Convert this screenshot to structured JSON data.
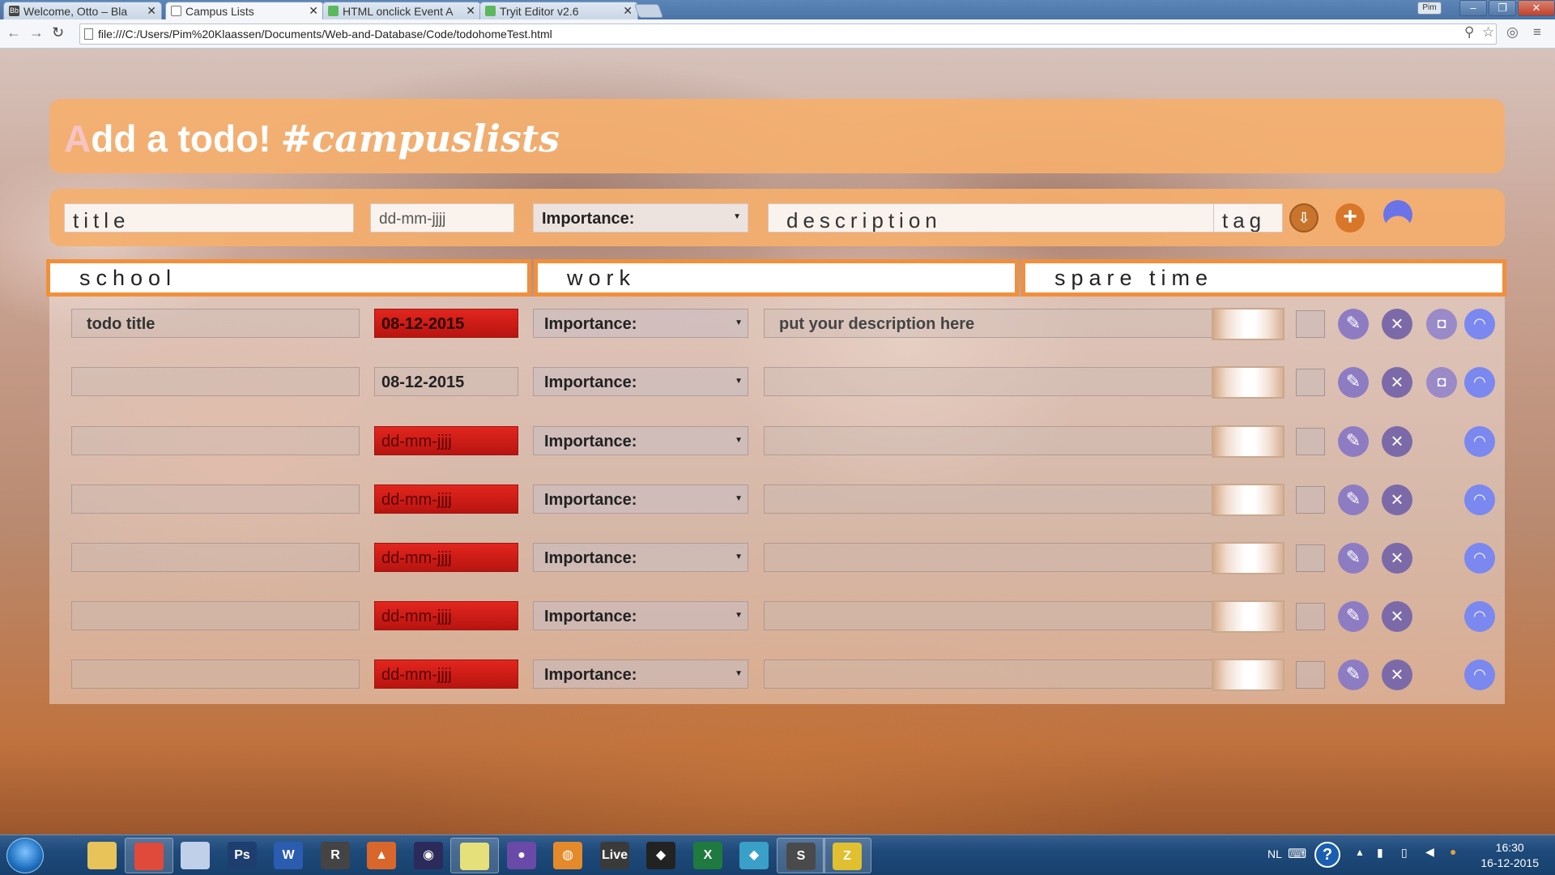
{
  "browser": {
    "tabs": [
      {
        "label": "Welcome, Otto – Bla",
        "icon": "blackboard-icon",
        "icon_color": "#444444"
      },
      {
        "label": "Campus Lists",
        "icon": "page-icon",
        "icon_color": "#ffffff",
        "active": true
      },
      {
        "label": "HTML onclick Event A",
        "icon": "w3schools-icon",
        "icon_color": "#5cb85c"
      },
      {
        "label": "Tryit Editor v2.6",
        "icon": "w3schools-icon",
        "icon_color": "#5cb85c"
      }
    ],
    "url": "file:///C:/Users/Pim%20Klaassen/Documents/Web-and-Database/Code/todohomeTest.html",
    "profile_badge": "Pim",
    "window_buttons": {
      "minimize": "–",
      "maximize": "❐",
      "close": "✕"
    }
  },
  "header": {
    "first_letter": "A",
    "rest": "dd a todo!",
    "tagline": "#campuslists"
  },
  "new_todo": {
    "title_placeholder": "title",
    "date_placeholder": "dd-mm-jjjj",
    "importance_label": "Importance:",
    "description_placeholder": "description",
    "tag_placeholder": "tag"
  },
  "categories": [
    "school",
    "work",
    "spare time"
  ],
  "todos": [
    {
      "title": "todo title",
      "date": "08-12-2015",
      "overdue": true,
      "importance": "Importance:",
      "description": "put your description here",
      "has_save": true
    },
    {
      "title": "",
      "date": "08-12-2015",
      "overdue": false,
      "importance": "Importance:",
      "description": "",
      "has_save": true
    },
    {
      "title": "",
      "date": "dd-mm-jjjj",
      "overdue": true,
      "importance": "Importance:",
      "description": "",
      "has_save": false
    },
    {
      "title": "",
      "date": "dd-mm-jjjj",
      "overdue": true,
      "importance": "Importance:",
      "description": "",
      "has_save": false
    },
    {
      "title": "",
      "date": "dd-mm-jjjj",
      "overdue": true,
      "importance": "Importance:",
      "description": "",
      "has_save": false
    },
    {
      "title": "",
      "date": "dd-mm-jjjj",
      "overdue": true,
      "importance": "Importance:",
      "description": "",
      "has_save": false
    },
    {
      "title": "",
      "date": "dd-mm-jjjj",
      "overdue": true,
      "importance": "Importance:",
      "description": "",
      "has_save": false
    }
  ],
  "colors": {
    "panel_orange": "#f5af6e",
    "tab_border": "#f28f3a",
    "overdue_red": "#d01e18",
    "edit_purple": "#8e7cc3",
    "user_blue": "#7a88f0"
  },
  "taskbar": {
    "apps": [
      {
        "name": "explorer-icon",
        "label": "",
        "color": "#e8c35a"
      },
      {
        "name": "chrome-icon",
        "label": "",
        "color": "#e04a3a",
        "active": true
      },
      {
        "name": "paint-icon",
        "label": "",
        "color": "#c0d0e8"
      },
      {
        "name": "photoshop-icon",
        "label": "Ps",
        "color": "#1f3e70"
      },
      {
        "name": "word-icon",
        "label": "W",
        "color": "#2b5cb0"
      },
      {
        "name": "rhino-icon",
        "label": "R",
        "color": "#444444"
      },
      {
        "name": "matlab-icon",
        "label": "▲",
        "color": "#d9662a"
      },
      {
        "name": "eclipse-icon",
        "label": "◉",
        "color": "#2c2a5a"
      },
      {
        "name": "notes-icon",
        "label": "",
        "color": "#e6e07a",
        "active": true
      },
      {
        "name": "github-icon",
        "label": "●",
        "color": "#6a4aa8"
      },
      {
        "name": "blender-icon",
        "label": "◍",
        "color": "#e48a2a"
      },
      {
        "name": "live-icon",
        "label": "Live",
        "color": "#3a3a3a"
      },
      {
        "name": "unity-icon",
        "label": "◆",
        "color": "#222222"
      },
      {
        "name": "excel-icon",
        "label": "X",
        "color": "#1e7a3e"
      },
      {
        "name": "sourcetree-icon",
        "label": "◆",
        "color": "#3aa0c8"
      },
      {
        "name": "sublime-icon",
        "label": "S",
        "color": "#4a4a4a",
        "active": true
      },
      {
        "name": "filezilla-icon",
        "label": "Z",
        "color": "#e0c030",
        "active": true
      }
    ],
    "lang": "NL",
    "time": "16:30",
    "date": "16-12-2015"
  }
}
